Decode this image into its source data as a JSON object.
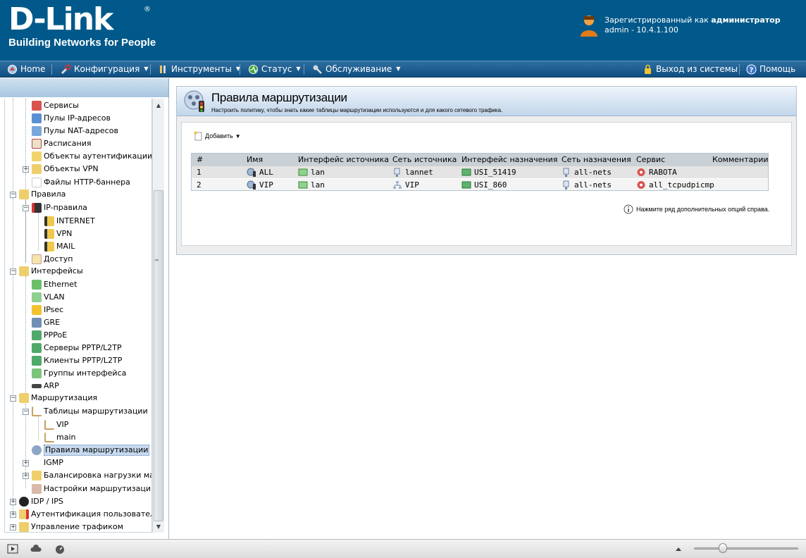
{
  "header": {
    "logo_main": "D-Link",
    "logo_reg": "®",
    "logo_sub": "Building Networks for People",
    "user_line1_prefix": "Зарегистрированный как",
    "user_role": "администратор",
    "user_line2": "admin - 10.4.1.100"
  },
  "nav": {
    "home": "Home",
    "config": "Конфигурация",
    "tools": "Инструменты",
    "status": "Статус",
    "maintenance": "Обслуживание",
    "logout": "Выход из системы",
    "help": "Помощь"
  },
  "tree": {
    "services": "Сервисы",
    "ip_pools": "Пулы IP-адресов",
    "nat_pools": "Пулы NAT-адресов",
    "schedules": "Расписания",
    "auth_objects": "Объекты аутентификации",
    "vpn_objects": "Объекты VPN",
    "http_banner": "Файлы HTTP-баннера",
    "rules": "Правила",
    "ip_rules": "IP-правила",
    "internet": "INTERNET",
    "vpn": "VPN",
    "mail": "MAIL",
    "access": "Доступ",
    "interfaces": "Интерфейсы",
    "ethernet": "Ethernet",
    "vlan": "VLAN",
    "ipsec": "IPsec",
    "gre": "GRE",
    "pppoe": "PPPoE",
    "pptp_servers": "Серверы PPTP/L2TP",
    "pptp_clients": "Клиенты PPTP/L2TP",
    "iface_groups": "Группы интерфейса",
    "arp": "ARP",
    "routing": "Маршрутизация",
    "routing_tables": "Таблицы маршрутизации",
    "rt_vip": "VIP",
    "rt_main": "main",
    "routing_rules": "Правила маршрутизации",
    "igmp": "IGMP",
    "load_balancing": "Балансировка нагрузки марш",
    "routing_settings": "Настройки маршрутизации",
    "idp_ips": "IDP / IPS",
    "user_auth": "Аутентификация пользователя",
    "traffic_mgmt": "Управление трафиком"
  },
  "page": {
    "title": "Правила маршрутизации",
    "subtitle": "Настроить политику, чтобы знать какие таблицы маршрутизации используются и для какого сетевого трафика.",
    "add_label": "Добавить",
    "hint": "Нажмите ряд дополнительных опций справа."
  },
  "table": {
    "headers": {
      "num": "#",
      "name": "Имя",
      "src_iface": "Интерфейс источника",
      "src_net": "Сеть источника",
      "dst_iface": "Интерфейс назначения",
      "dst_net": "Сеть назначения",
      "service": "Сервис",
      "comments": "Комментарии"
    },
    "rows": [
      {
        "num": "1",
        "name": "ALL",
        "src_iface": "lan",
        "src_net": "lannet",
        "dst_iface": "USI_51419",
        "dst_net": "all-nets",
        "service": "RABOTA"
      },
      {
        "num": "2",
        "name": "VIP",
        "src_iface": "lan",
        "src_net": "VIP",
        "dst_iface": "USI_860",
        "dst_net": "all-nets",
        "service": "all_tcpudpicmp"
      }
    ]
  },
  "colors": {
    "header_bg": "#00598a",
    "nav_bg": "#0e4e80",
    "selection": "#c6d9ef"
  }
}
